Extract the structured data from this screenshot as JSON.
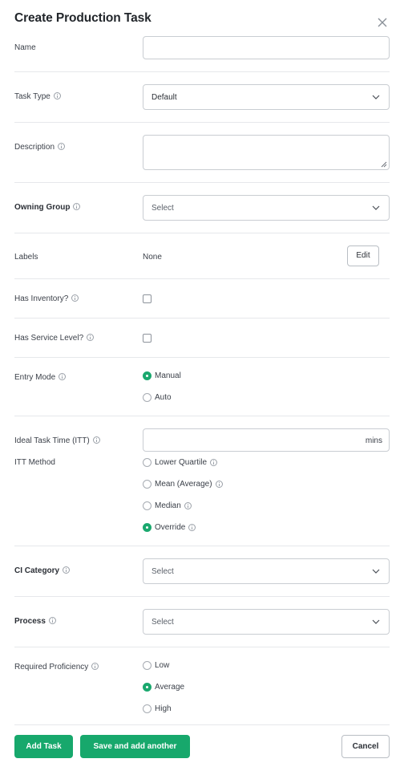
{
  "dialog": {
    "title": "Create Production Task"
  },
  "fields": {
    "name": {
      "label": "Name",
      "value": ""
    },
    "task_type": {
      "label": "Task Type",
      "value": "Default"
    },
    "description": {
      "label": "Description",
      "value": ""
    },
    "owning_group": {
      "label": "Owning Group",
      "placeholder": "Select"
    },
    "labels": {
      "label": "Labels",
      "value": "None",
      "edit_label": "Edit"
    },
    "has_inventory": {
      "label": "Has Inventory?",
      "checked": false
    },
    "has_service_level": {
      "label": "Has Service Level?",
      "checked": false
    },
    "entry_mode": {
      "label": "Entry Mode",
      "options": [
        {
          "label": "Manual",
          "selected": true
        },
        {
          "label": "Auto",
          "selected": false
        }
      ]
    },
    "ideal_task_time": {
      "label": "Ideal Task Time (ITT)",
      "value": "",
      "suffix": "mins"
    },
    "itt_method": {
      "label": "ITT Method",
      "options": [
        {
          "label": "Lower Quartile",
          "selected": false
        },
        {
          "label": "Mean (Average)",
          "selected": false
        },
        {
          "label": "Median",
          "selected": false
        },
        {
          "label": "Override",
          "selected": true
        }
      ]
    },
    "ci_category": {
      "label": "CI Category",
      "placeholder": "Select"
    },
    "process": {
      "label": "Process",
      "placeholder": "Select"
    },
    "required_proficiency": {
      "label": "Required Proficiency",
      "options": [
        {
          "label": "Low",
          "selected": false
        },
        {
          "label": "Average",
          "selected": true
        },
        {
          "label": "High",
          "selected": false
        }
      ]
    }
  },
  "footer": {
    "add_task": "Add Task",
    "save_and_add_another": "Save and add another",
    "cancel": "Cancel"
  },
  "colors": {
    "accent": "#17a86c",
    "border": "#c9cdd2",
    "divider": "#e6e8eb"
  }
}
